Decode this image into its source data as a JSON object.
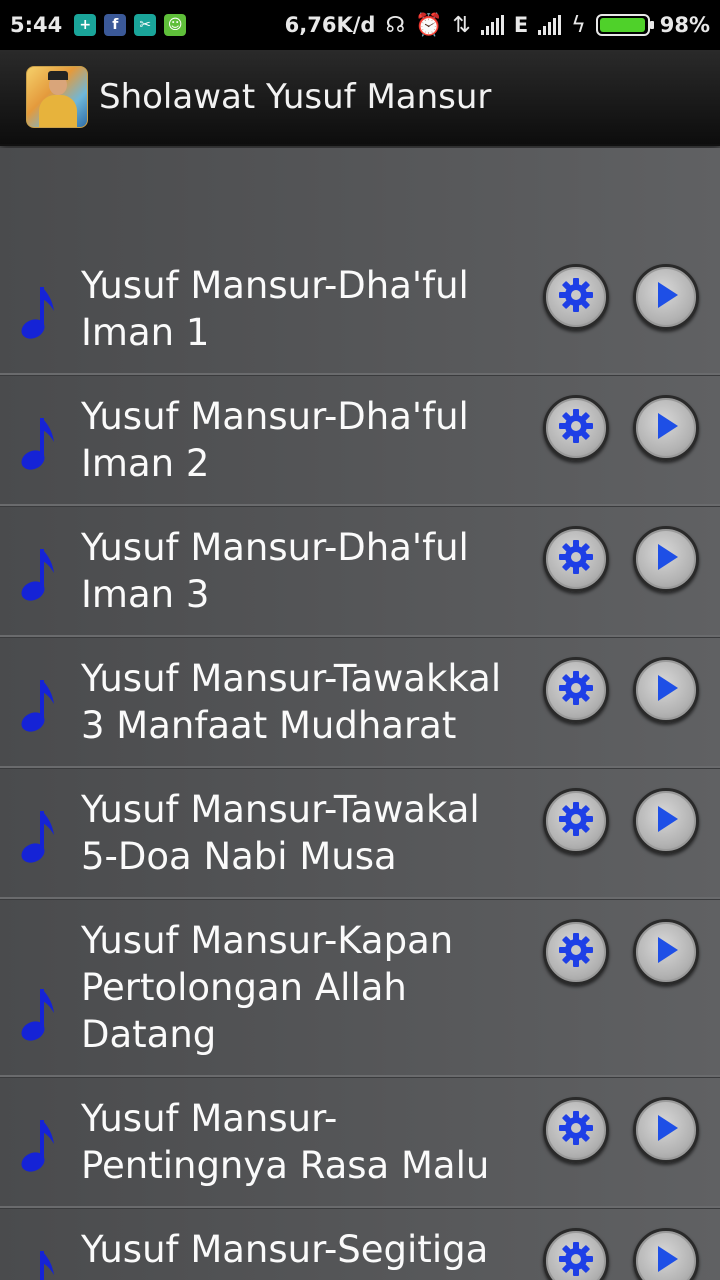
{
  "status_bar": {
    "time": "5:44",
    "network_speed": "6,76K/d",
    "network_type": "E",
    "battery_percent": "98%",
    "battery_level": 0.98,
    "left_icons": [
      "security-icon",
      "facebook-icon",
      "app-icon",
      "android-icon"
    ],
    "right_icons": [
      "headset-icon",
      "alarm-icon",
      "data-transfer-icon",
      "signal-icon",
      "charging-icon",
      "battery-icon"
    ]
  },
  "app": {
    "title": "Sholawat Yusuf Mansur"
  },
  "colors": {
    "note": "#1523d6",
    "settings_gear": "#1e3fe6",
    "play": "#1e4fe6",
    "battery": "#4fd12a"
  },
  "tracks": [
    {
      "title": "Yusuf Mansur-Dha'ful Iman 1"
    },
    {
      "title": "Yusuf Mansur-Dha'ful Iman 2"
    },
    {
      "title": "Yusuf Mansur-Dha'ful Iman 3"
    },
    {
      "title": "Yusuf Mansur-Tawakkal 3 Manfaat Mudharat"
    },
    {
      "title": "Yusuf Mansur-Tawakal 5-Doa Nabi Musa"
    },
    {
      "title": "Yusuf Mansur-Kapan Pertolongan Allah Datang"
    },
    {
      "title": "Yusuf Mansur-Pentingnya Rasa Malu"
    },
    {
      "title": "Yusuf Mansur-Segitiga"
    }
  ]
}
